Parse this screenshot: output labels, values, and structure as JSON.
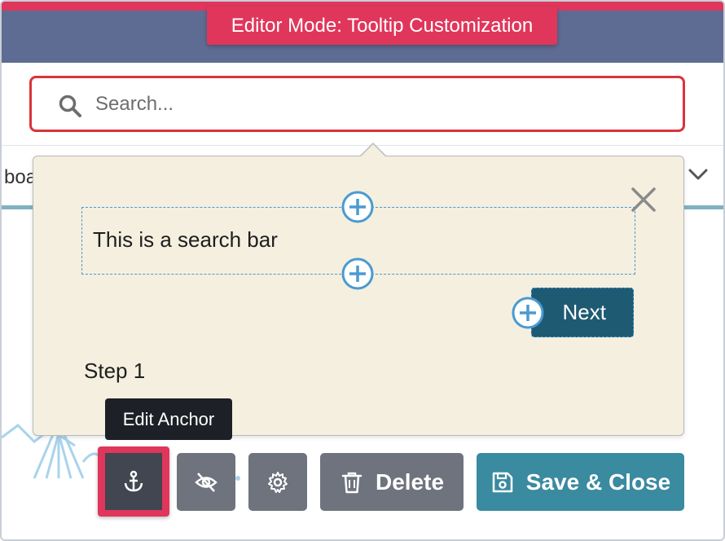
{
  "banner": {
    "label": "Editor Mode: Tooltip Customization"
  },
  "search": {
    "placeholder": "Search..."
  },
  "background_nav": {
    "partial_text": "boa"
  },
  "tooltip": {
    "text": "This is a search bar",
    "next_label": "Next",
    "step_label": "Step 1"
  },
  "anchor_tooltip": {
    "label": "Edit Anchor"
  },
  "toolbar": {
    "delete_label": "Delete",
    "save_close_label": "Save & Close"
  },
  "colors": {
    "accent": "#e0365b",
    "next_button": "#1f5a73",
    "save_button": "#3a8aa0",
    "tooltip_background": "#f4efdf",
    "plus_circle": "#4a9ad1"
  },
  "icons": [
    "search-icon",
    "chevron-down-icon",
    "close-icon",
    "plus-circle-icon",
    "anchor-icon",
    "eye-slash-icon",
    "gear-icon",
    "trash-icon",
    "save-icon"
  ]
}
